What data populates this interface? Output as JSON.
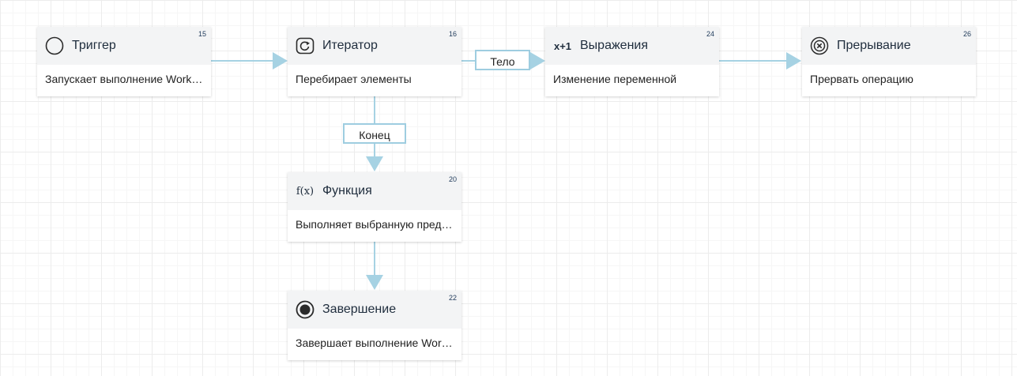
{
  "colors": {
    "edge": "#a6d2e3",
    "node_header": "#f3f4f5",
    "grid": "#ececec"
  },
  "nodes": {
    "trigger": {
      "number": "15",
      "title": "Триггер",
      "description": "Запускает выполнение Workflow",
      "icon": "circle-outline-icon"
    },
    "iterator": {
      "number": "16",
      "title": "Итератор",
      "description": "Перебирает элементы",
      "icon": "loop-icon"
    },
    "expressions": {
      "number": "24",
      "title": "Выражения",
      "description": "Изменение переменной",
      "icon": "x-plus-one-icon",
      "icon_text": "x+1"
    },
    "interrupt": {
      "number": "26",
      "title": "Прерывание",
      "description": "Прервать операцию",
      "icon": "cancel-circle-icon"
    },
    "function": {
      "number": "20",
      "title": "Функция",
      "description": "Выполняет выбранную предопределённую функцию",
      "icon": "function-icon",
      "icon_text": "f(x)"
    },
    "finish": {
      "number": "22",
      "title": "Завершение",
      "description": "Завершает выполнение Workflow",
      "icon": "stop-circle-icon"
    }
  },
  "edge_labels": {
    "body": "Тело",
    "end": "Конец"
  }
}
